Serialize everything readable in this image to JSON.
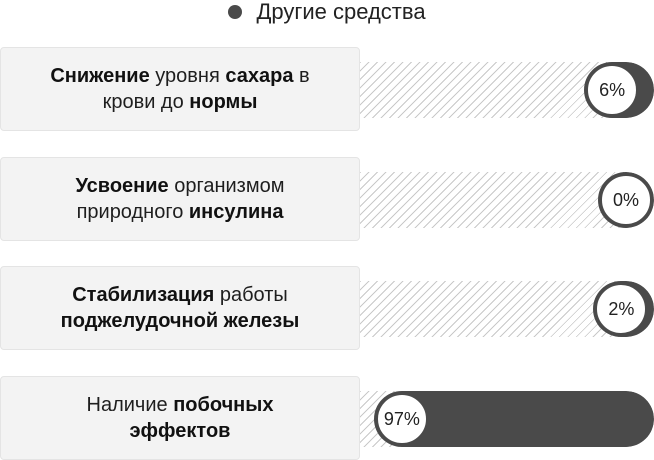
{
  "chart_data": {
    "type": "bar",
    "orientation": "horizontal",
    "direction": "right-to-left",
    "legend": "top-center",
    "grid": false,
    "series": [
      {
        "name": "Другие средства",
        "color": "#4a4a4a"
      }
    ],
    "categories": [
      [
        [
          "Снижение",
          " уровня ",
          "сахара",
          " в"
        ],
        [
          "крови до ",
          "нормы"
        ]
      ],
      [
        [
          "Усвоение",
          " организмом"
        ],
        [
          "природного ",
          "инсулина"
        ]
      ],
      [
        [
          "Стабилизация",
          " работы"
        ],
        [
          "поджелудочной железы"
        ]
      ],
      [
        [
          "Наличие ",
          "побочных"
        ],
        [
          "эффектов"
        ]
      ]
    ],
    "values": [
      6,
      0,
      2,
      97
    ],
    "value_labels": [
      "6%",
      "0%",
      "2%",
      "97%"
    ],
    "xlim": [
      0,
      100
    ]
  },
  "colors": {
    "bar": "#4a4a4a",
    "label_background": "#f3f3f3",
    "label_border": "#e4e4e4",
    "hatch": "#c9c9c9"
  }
}
